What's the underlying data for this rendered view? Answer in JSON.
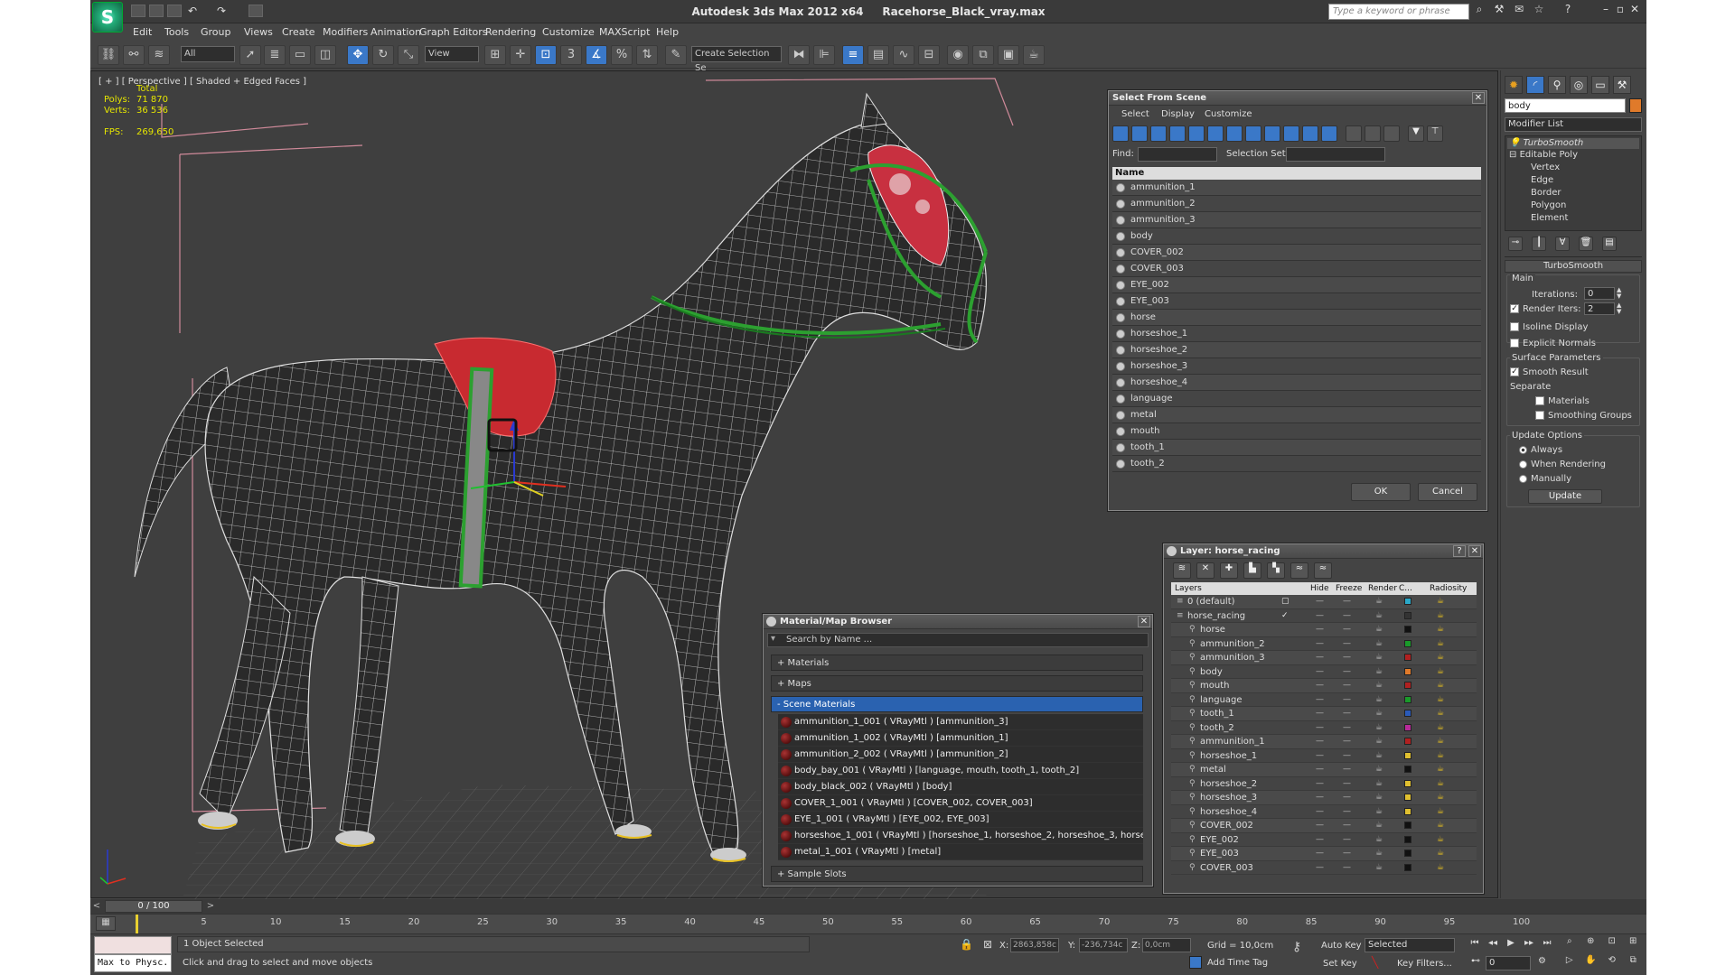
{
  "app": {
    "title": "Autodesk 3ds Max  2012 x64",
    "filename": "Racehorse_Black_vray.max",
    "search_placeholder": "Type a keyword or phrase"
  },
  "menu": [
    "Edit",
    "Tools",
    "Group",
    "Views",
    "Create",
    "Modifiers",
    "Animation",
    "Graph Editors",
    "Rendering",
    "Customize",
    "MAXScript",
    "Help"
  ],
  "toolbar": {
    "selection_filter": "All",
    "reference_coord": "View",
    "named_selection": "Create Selection Se"
  },
  "viewport": {
    "label": "[ + ] [ Perspective ] [ Shaded + Edged Faces ]",
    "stats": {
      "total_label": "Total",
      "polys_label": "Polys:",
      "polys": "71 870",
      "verts_label": "Verts:",
      "verts": "36 536",
      "fps_label": "FPS:",
      "fps": "269,650"
    }
  },
  "command_panel": {
    "object_name": "body",
    "object_color": "#e07a2a",
    "modifier_list": "Modifier List",
    "stack": [
      "TurboSmooth",
      "Editable Poly",
      "Vertex",
      "Edge",
      "Border",
      "Polygon",
      "Element"
    ],
    "rollout_title": "TurboSmooth",
    "main_label": "Main",
    "iterations_label": "Iterations:",
    "iterations": "0",
    "render_iters_label": "Render Iters:",
    "render_iters": "2",
    "isoline_label": "Isoline Display",
    "explicit_normals_label": "Explicit Normals",
    "surface_params_label": "Surface Parameters",
    "smooth_result_label": "Smooth Result",
    "separate_label": "Separate",
    "materials_label": "Materials",
    "smoothing_groups_label": "Smoothing Groups",
    "update_options_label": "Update Options",
    "always_label": "Always",
    "when_rendering_label": "When Rendering",
    "manually_label": "Manually",
    "update_button": "Update"
  },
  "select_from_scene": {
    "title": "Select From Scene",
    "menus": [
      "Select",
      "Display",
      "Customize"
    ],
    "find_label": "Find:",
    "selection_set_label": "Selection Set:",
    "column_name": "Name",
    "items": [
      "ammunition_1",
      "ammunition_2",
      "ammunition_3",
      "body",
      "COVER_002",
      "COVER_003",
      "EYE_002",
      "EYE_003",
      "horse",
      "horseshoe_1",
      "horseshoe_2",
      "horseshoe_3",
      "horseshoe_4",
      "language",
      "metal",
      "mouth",
      "tooth_1",
      "tooth_2"
    ],
    "ok": "OK",
    "cancel": "Cancel"
  },
  "layer_dialog": {
    "title": "Layer: horse_racing",
    "columns": [
      "Layers",
      "Hide",
      "Freeze",
      "Render",
      "C...",
      "Radiosity"
    ],
    "rows": [
      {
        "name": "0 (default)",
        "color": "#2aa8c8"
      },
      {
        "name": "horse_racing",
        "color": "#333333"
      },
      {
        "name": "horse",
        "color": "#111111"
      },
      {
        "name": "ammunition_2",
        "color": "#1a9a2a"
      },
      {
        "name": "ammunition_3",
        "color": "#b02020"
      },
      {
        "name": "body",
        "color": "#e07a2a"
      },
      {
        "name": "mouth",
        "color": "#b02020"
      },
      {
        "name": "language",
        "color": "#1a9a2a"
      },
      {
        "name": "tooth_1",
        "color": "#2a5ab8"
      },
      {
        "name": "tooth_2",
        "color": "#b82a9a"
      },
      {
        "name": "ammunition_1",
        "color": "#b02020"
      },
      {
        "name": "horseshoe_1",
        "color": "#e0c030"
      },
      {
        "name": "metal",
        "color": "#111111"
      },
      {
        "name": "horseshoe_2",
        "color": "#e0c030"
      },
      {
        "name": "horseshoe_3",
        "color": "#e0c030"
      },
      {
        "name": "horseshoe_4",
        "color": "#e0c030"
      },
      {
        "name": "COVER_002",
        "color": "#111111"
      },
      {
        "name": "EYE_002",
        "color": "#111111"
      },
      {
        "name": "EYE_003",
        "color": "#111111"
      },
      {
        "name": "COVER_003",
        "color": "#111111"
      }
    ]
  },
  "material_browser": {
    "title": "Material/Map Browser",
    "search_placeholder": "Search by Name ...",
    "cat_materials": "+ Materials",
    "cat_maps": "+ Maps",
    "cat_scene": "- Scene Materials",
    "cat_samples": "+ Sample Slots",
    "items": [
      "ammunition_1_001  ( VRayMtl )  [ammunition_3]",
      "ammunition_1_002  ( VRayMtl )  [ammunition_1]",
      "ammunition_2_002  ( VRayMtl )  [ammunition_2]",
      "body_bay_001  ( VRayMtl )  [language, mouth, tooth_1, tooth_2]",
      "body_black_002  ( VRayMtl )  [body]",
      "COVER_1_001  ( VRayMtl )  [COVER_002, COVER_003]",
      "EYE_1_001  ( VRayMtl )  [EYE_002, EYE_003]",
      "horseshoe_1_001  ( VRayMtl )  [horseshoe_1, horseshoe_2, horseshoe_3, horses...",
      "metal_1_001  ( VRayMtl )  [metal]"
    ]
  },
  "timeline": {
    "frame": "0 / 100",
    "ticks": [
      "5",
      "10",
      "15",
      "20",
      "25",
      "30",
      "35",
      "40",
      "45",
      "50",
      "55",
      "60",
      "65",
      "70",
      "75",
      "80",
      "85",
      "90",
      "95",
      "100"
    ]
  },
  "status": {
    "maxscript": "Max to Physc.",
    "selected": "1 Object Selected",
    "prompt": "Click and drag to select and move objects",
    "x_label": "X:",
    "x": "2863,858c",
    "y_label": "Y:",
    "y": "-236,734c",
    "z_label": "Z:",
    "z": "0,0cm",
    "grid": "Grid = 10,0cm",
    "add_time_tag": "Add Time Tag",
    "auto_key": "Auto Key",
    "key_mode": "Selected",
    "set_key": "Set Key",
    "key_filters": "Key Filters...",
    "current_frame": "0"
  }
}
